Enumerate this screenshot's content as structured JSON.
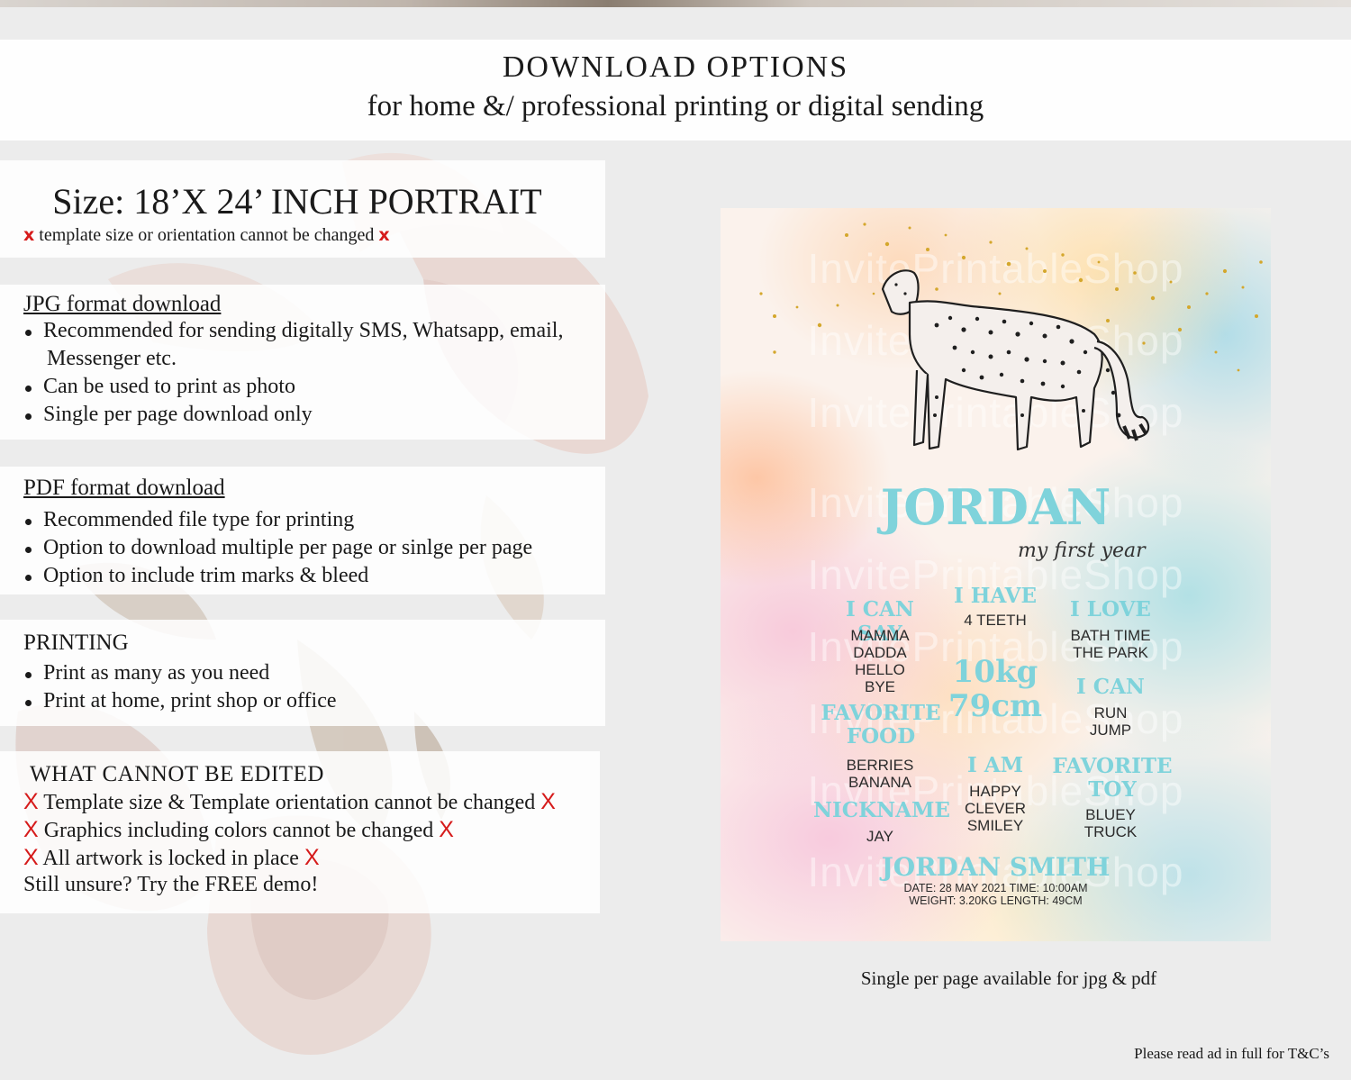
{
  "header": {
    "title": "DOWNLOAD OPTIONS",
    "subtitle": "for home &/ professional printing or digital sending"
  },
  "size_panel": {
    "title": "Size: 18’X 24’ INCH PORTRAIT",
    "note": "template size or orientation cannot be changed",
    "mark": "x"
  },
  "jpg_panel": {
    "title": "JPG format download",
    "items": [
      "Recommended for sending digitally SMS, Whatsapp, email,",
      "Can be used to print as photo",
      "Single per page download only"
    ],
    "item0_cont": "Messenger etc."
  },
  "pdf_panel": {
    "title": "PDF format download",
    "items": [
      "Recommended file type for printing",
      "Option to download multiple per page or sinlge per page",
      "Option to include trim marks & bleed"
    ]
  },
  "printing_panel": {
    "title": "PRINTING",
    "items": [
      "Print as many as you need",
      "Print at home, print shop or office"
    ]
  },
  "cannot_panel": {
    "title": "WHAT CANNOT BE EDITED",
    "mark": "X",
    "lines": [
      "Template size & Template orientation cannot be changed",
      "Graphics including colors cannot be changed",
      "All artwork is locked in place"
    ],
    "footer": "Still unsure? Try the FREE demo!"
  },
  "poster": {
    "watermark": "InvitePrintableShop",
    "name": "JORDAN",
    "tagline": "my first year",
    "i_can_say": {
      "label": "I CAN SAY",
      "lines": [
        "MAMMA",
        "DADDA",
        "HELLO",
        "BYE"
      ]
    },
    "i_have": {
      "label": "I HAVE",
      "lines": [
        "4 TEETH"
      ]
    },
    "i_love": {
      "label": "I LOVE",
      "lines": [
        "BATH TIME",
        "THE PARK"
      ]
    },
    "weight": "10kg",
    "height": "79cm",
    "i_can": {
      "label": "I CAN",
      "lines": [
        "RUN",
        "JUMP"
      ]
    },
    "favorite_food": {
      "label1": "FAVORITE",
      "label2": "FOOD",
      "lines": [
        "BERRIES",
        "BANANA"
      ]
    },
    "i_am": {
      "label": "I AM",
      "lines": [
        "HAPPY",
        "CLEVER",
        "SMILEY"
      ]
    },
    "favorite_toy": {
      "label1": "FAVORITE",
      "label2": "TOY",
      "lines": [
        "BLUEY",
        "TRUCK"
      ]
    },
    "nickname": {
      "label": "NICKNAME",
      "lines": [
        "JAY"
      ]
    },
    "full_name": "JORDAN SMITH",
    "birth_line1": "DATE: 28 MAY 2021 TIME: 10:00AM",
    "birth_line2": "WEIGHT: 3.20KG LENGTH: 49CM",
    "accent_color": "#7fd3db"
  },
  "caption": "Single per page available for jpg & pdf",
  "terms_note": "Please read ad in full for T&C’s"
}
